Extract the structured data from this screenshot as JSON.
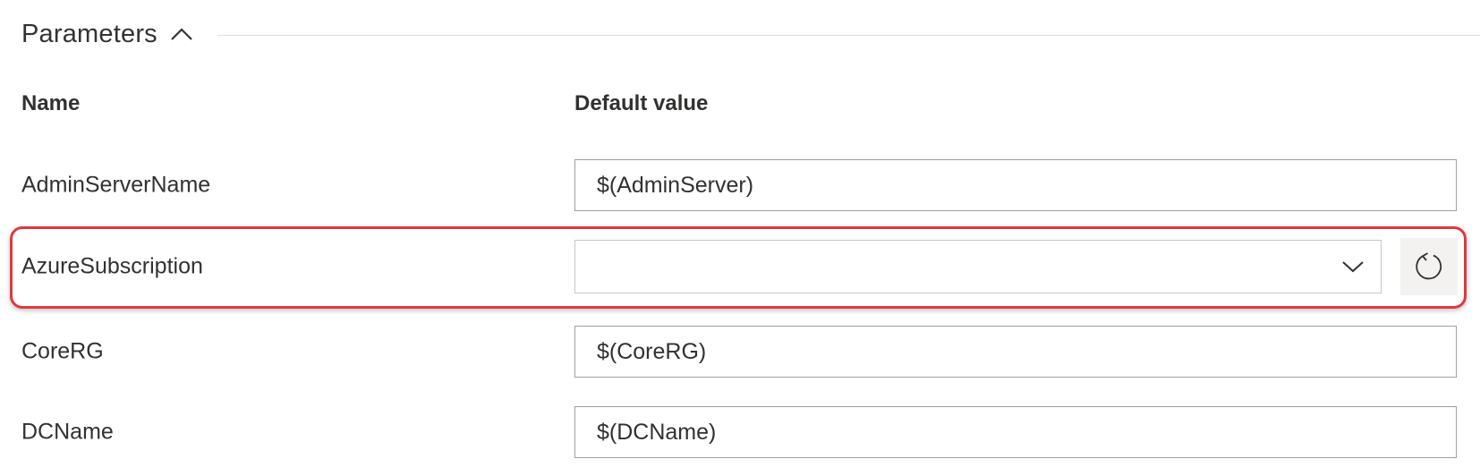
{
  "section": {
    "title": "Parameters",
    "toggle_icon": "chevron-up-icon"
  },
  "columns": {
    "name": "Name",
    "default_value": "Default value"
  },
  "params": [
    {
      "name": "AdminServerName",
      "value": "$(AdminServer)",
      "kind": "text"
    },
    {
      "name": "AzureSubscription",
      "value": "",
      "kind": "dropdown",
      "dropdown_icon": "chevron-down-icon",
      "action_icon": "refresh-icon"
    },
    {
      "name": "CoreRG",
      "value": "$(CoreRG)",
      "kind": "text"
    },
    {
      "name": "DCName",
      "value": "$(DCName)",
      "kind": "text"
    }
  ],
  "highlight": {
    "target": "AzureSubscription",
    "color": "#e0393e"
  }
}
